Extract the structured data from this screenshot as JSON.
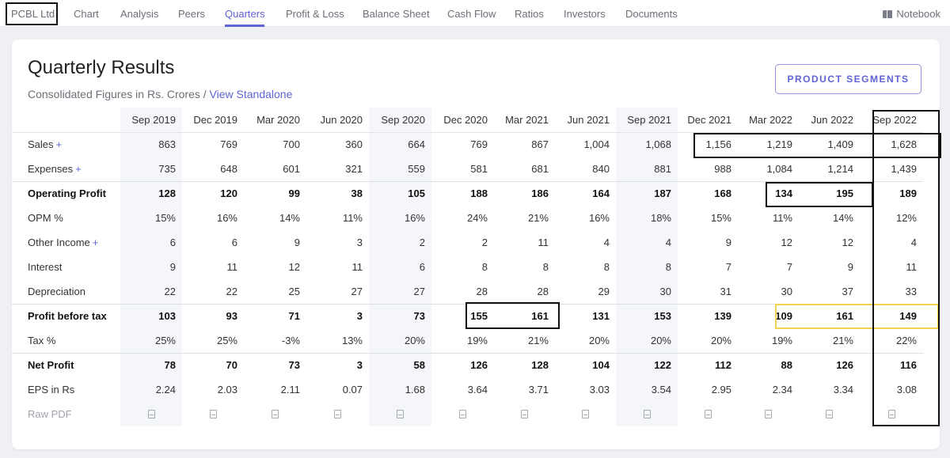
{
  "nav": {
    "brand": "PCBL Ltd",
    "items": [
      "Chart",
      "Analysis",
      "Peers",
      "Quarters",
      "Profit & Loss",
      "Balance Sheet",
      "Cash Flow",
      "Ratios",
      "Investors",
      "Documents"
    ],
    "active": "Quarters",
    "notebook": "Notebook"
  },
  "card": {
    "title": "Quarterly Results",
    "subtitle": "Consolidated Figures in Rs. Crores / ",
    "subtitle_link": "View Standalone",
    "segments_button": "PRODUCT SEGMENTS"
  },
  "table": {
    "columns": [
      "Sep 2019",
      "Dec 2019",
      "Mar 2020",
      "Jun 2020",
      "Sep 2020",
      "Dec 2020",
      "Mar 2021",
      "Jun 2021",
      "Sep 2021",
      "Dec 2021",
      "Mar 2022",
      "Jun 2022",
      "Sep 2022"
    ],
    "rows": [
      {
        "label": "Sales",
        "plus": "+",
        "values": [
          "863",
          "769",
          "700",
          "360",
          "664",
          "769",
          "867",
          "1,004",
          "1,068",
          "1,156",
          "1,219",
          "1,409",
          "1,628"
        ]
      },
      {
        "label": "Expenses",
        "plus": "+",
        "values": [
          "735",
          "648",
          "601",
          "321",
          "559",
          "581",
          "681",
          "840",
          "881",
          "988",
          "1,084",
          "1,214",
          "1,439"
        ]
      },
      {
        "label": "Operating Profit",
        "values": [
          "128",
          "120",
          "99",
          "38",
          "105",
          "188",
          "186",
          "164",
          "187",
          "168",
          "134",
          "195",
          "189"
        ]
      },
      {
        "label": "OPM %",
        "values": [
          "15%",
          "16%",
          "14%",
          "11%",
          "16%",
          "24%",
          "21%",
          "16%",
          "18%",
          "15%",
          "11%",
          "14%",
          "12%"
        ]
      },
      {
        "label": "Other Income",
        "plus": "+",
        "values": [
          "6",
          "6",
          "9",
          "3",
          "2",
          "2",
          "11",
          "4",
          "4",
          "9",
          "12",
          "12",
          "4"
        ]
      },
      {
        "label": "Interest",
        "values": [
          "9",
          "11",
          "12",
          "11",
          "6",
          "8",
          "8",
          "8",
          "8",
          "7",
          "7",
          "9",
          "11"
        ]
      },
      {
        "label": "Depreciation",
        "values": [
          "22",
          "22",
          "25",
          "27",
          "27",
          "28",
          "28",
          "29",
          "30",
          "31",
          "30",
          "37",
          "33"
        ]
      },
      {
        "label": "Profit before tax",
        "values": [
          "103",
          "93",
          "71",
          "3",
          "73",
          "155",
          "161",
          "131",
          "153",
          "139",
          "109",
          "161",
          "149"
        ]
      },
      {
        "label": "Tax %",
        "values": [
          "25%",
          "25%",
          "-3%",
          "13%",
          "20%",
          "19%",
          "21%",
          "20%",
          "20%",
          "20%",
          "19%",
          "21%",
          "22%"
        ]
      },
      {
        "label": "Net Profit",
        "values": [
          "78",
          "70",
          "73",
          "3",
          "58",
          "126",
          "128",
          "104",
          "122",
          "112",
          "88",
          "126",
          "116"
        ]
      },
      {
        "label": "EPS in Rs",
        "values": [
          "2.24",
          "2.03",
          "2.11",
          "0.07",
          "1.68",
          "3.64",
          "3.71",
          "3.03",
          "3.54",
          "2.95",
          "2.34",
          "3.34",
          "3.08"
        ]
      },
      {
        "label": "Raw PDF",
        "pdf": true
      }
    ]
  },
  "colors": {
    "accent": "#5f63d6",
    "highlight_black": "#111111",
    "highlight_yellow": "#f1d24a",
    "shaded_column": "#f5f6f9"
  }
}
